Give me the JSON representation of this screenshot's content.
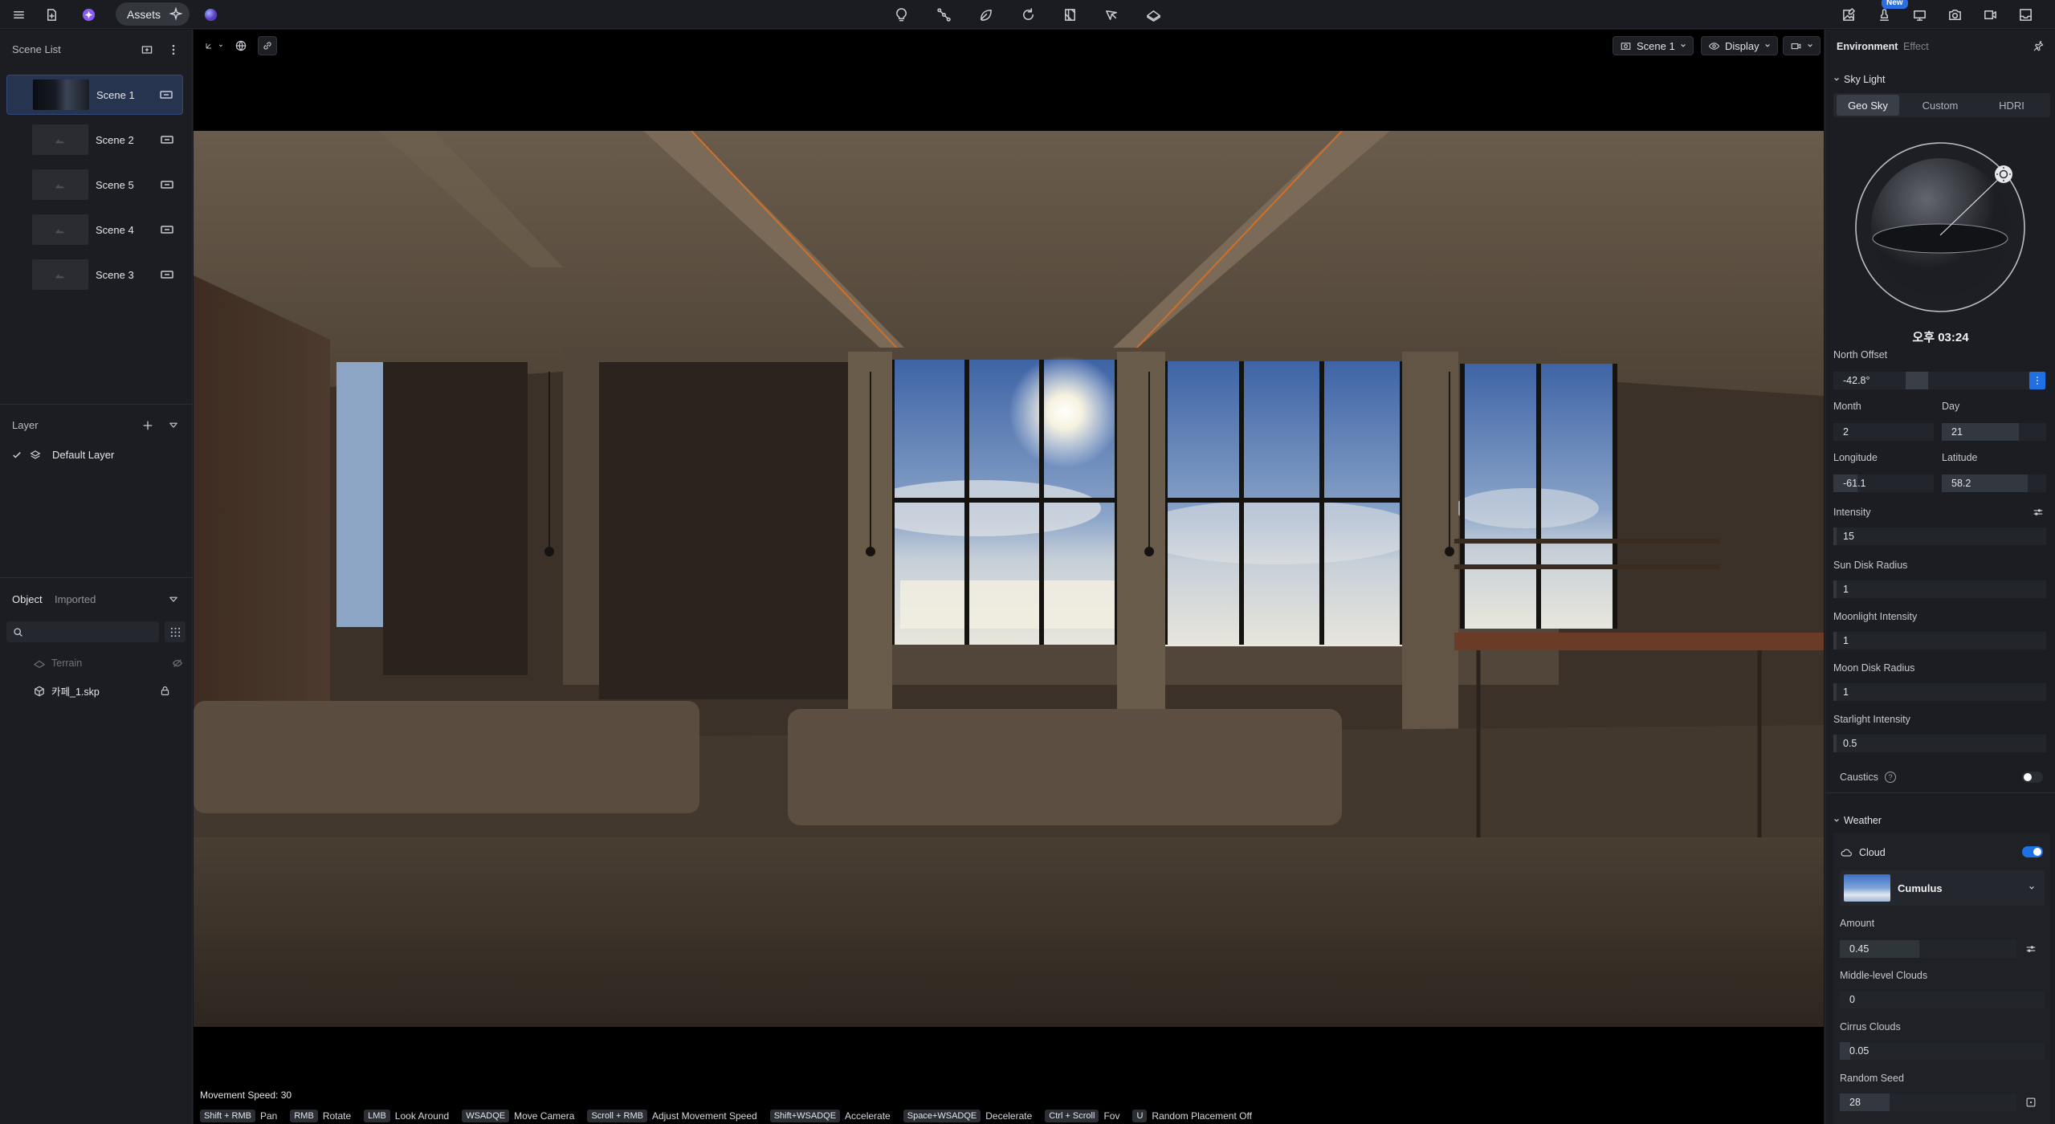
{
  "topbar": {
    "assets_label": "Assets",
    "new_badge": "New",
    "center_tools": [
      "lightbulb-icon",
      "path-icon",
      "leaf-icon",
      "refresh-icon",
      "grid-icon",
      "cursor-plane-icon",
      "terrain-icon"
    ],
    "right_tools": [
      "image-edit-icon",
      "stamp-icon",
      "monitor-icon",
      "camera-icon",
      "video-icon",
      "inbox-icon"
    ]
  },
  "scene_list": {
    "title": "Scene List",
    "scenes": [
      {
        "name": "Scene 1",
        "active": true
      },
      {
        "name": "Scene 2",
        "active": false
      },
      {
        "name": "Scene 5",
        "active": false
      },
      {
        "name": "Scene 4",
        "active": false
      },
      {
        "name": "Scene 3",
        "active": false
      }
    ]
  },
  "layer": {
    "title": "Layer",
    "items": [
      {
        "name": "Default Layer",
        "checked": true
      }
    ]
  },
  "objects": {
    "tabs": [
      "Object",
      "Imported"
    ],
    "active_tab": "Object",
    "search_placeholder": "",
    "items": [
      {
        "name": "Terrain",
        "hidden": true
      },
      {
        "name": "카페_1.skp",
        "locked": true
      }
    ]
  },
  "viewport": {
    "scene_selector": "Scene 1",
    "display_label": "Display",
    "movement_speed": "Movement Speed: 30",
    "shortcuts": [
      {
        "key": "Shift + RMB",
        "label": "Pan"
      },
      {
        "key": "RMB",
        "label": "Rotate"
      },
      {
        "key": "LMB",
        "label": "Look Around"
      },
      {
        "key": "WSADQE",
        "label": "Move Camera"
      },
      {
        "key": "Scroll + RMB",
        "label": "Adjust Movement Speed"
      },
      {
        "key": "Shift+WSADQE",
        "label": "Accelerate"
      },
      {
        "key": "Space+WSADQE",
        "label": "Decelerate"
      },
      {
        "key": "Ctrl + Scroll",
        "label": "Fov"
      },
      {
        "key": "U",
        "label": "Random Placement Off"
      }
    ]
  },
  "right_panel": {
    "tabs": [
      "Environment",
      "Effect"
    ],
    "active_tab": "Environment",
    "sky_light": {
      "title": "Sky Light",
      "modes": [
        "Geo Sky",
        "Custom",
        "HDRI"
      ],
      "active_mode": "Geo Sky",
      "time": "오후 03:24",
      "north_offset_label": "North Offset",
      "north_offset": "-42.8°",
      "month_label": "Month",
      "month": "2",
      "day_label": "Day",
      "day": "21",
      "longitude_label": "Longitude",
      "longitude": "-61.1",
      "latitude_label": "Latitude",
      "latitude": "58.2",
      "intensity_label": "Intensity",
      "intensity": "15",
      "sun_disk_label": "Sun Disk Radius",
      "sun_disk": "1",
      "moonlight_label": "Moonlight Intensity",
      "moonlight": "1",
      "moon_disk_label": "Moon Disk Radius",
      "moon_disk": "1",
      "starlight_label": "Starlight Intensity",
      "starlight": "0.5",
      "caustics_label": "Caustics",
      "caustics_on": false
    },
    "weather": {
      "title": "Weather",
      "cloud_label": "Cloud",
      "cloud_on": true,
      "cloud_type": "Cumulus",
      "amount_label": "Amount",
      "amount": "0.45",
      "middle_label": "Middle-level Clouds",
      "middle": "0",
      "cirrus_label": "Cirrus Clouds",
      "cirrus": "0.05",
      "seed_label": "Random Seed",
      "seed": "28"
    },
    "accent": "#1f6fe5"
  }
}
